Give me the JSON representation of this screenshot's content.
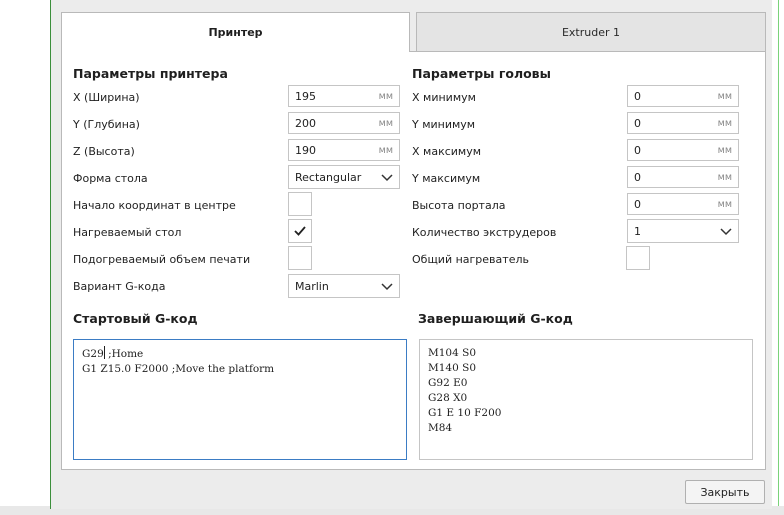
{
  "tabs": {
    "printer": "Принтер",
    "extruder": "Extruder 1"
  },
  "printer": {
    "title": "Параметры принтера",
    "x_label": "X (Ширина)",
    "x_value": "195",
    "y_label": "Y (Глубина)",
    "y_value": "200",
    "z_label": "Z (Высота)",
    "z_value": "190",
    "unit": "мм",
    "bed_shape_label": "Форма стола",
    "bed_shape_value": "Rectangular",
    "origin_center_label": "Начало координат в центре",
    "origin_center_checked": false,
    "heated_bed_label": "Нагреваемый стол",
    "heated_bed_checked": true,
    "heated_volume_label": "Подогреваемый объем печати",
    "heated_volume_checked": false,
    "gcode_flavor_label": "Вариант G-кода",
    "gcode_flavor_value": "Marlin"
  },
  "head": {
    "title": "Параметры головы",
    "xmin_label": "X минимум",
    "xmin_value": "0",
    "ymin_label": "Y минимум",
    "ymin_value": "0",
    "xmax_label": "X максимум",
    "xmax_value": "0",
    "ymax_label": "Y максимум",
    "ymax_value": "0",
    "gantry_label": "Высота портала",
    "gantry_value": "0",
    "unit": "мм",
    "extruder_count_label": "Количество экструдеров",
    "extruder_count_value": "1",
    "shared_heater_label": "Общий нагреватель",
    "shared_heater_checked": false
  },
  "start_gcode": {
    "title": "Стартовый G-код",
    "line1_before_caret": "G29",
    "line1_after_caret": " ;Home",
    "line2": "G1 Z15.0 F2000 ;Move the platform"
  },
  "end_gcode": {
    "title": "Завершающий G-код",
    "text": "M104 S0\nM140 S0\nG92 E0\nG28 X0\nG1 E 10 F200\nM84"
  },
  "footer": {
    "close_label": "Закрыть"
  },
  "icons": {
    "dropdown": "chevron-down-icon",
    "checkmark": "checkmark-icon"
  }
}
